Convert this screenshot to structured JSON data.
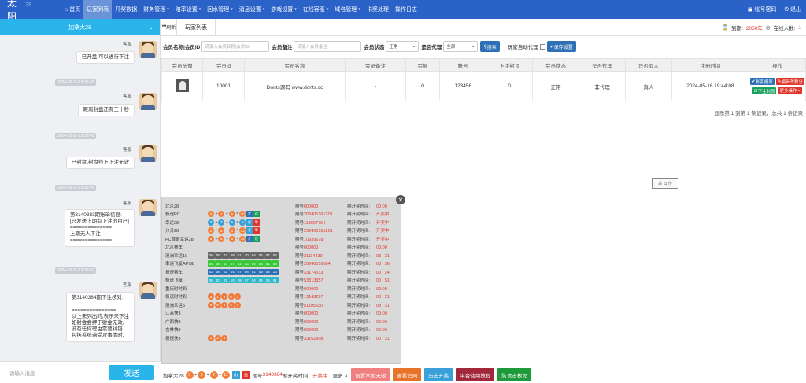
{
  "brand": {
    "name": "太阳",
    "sub": "28"
  },
  "nav": [
    {
      "label": "首页",
      "icon": "home-icon",
      "active": false
    },
    {
      "label": "玩家列表",
      "active": true
    },
    {
      "label": "开奖数据",
      "active": false
    },
    {
      "label": "财务管理",
      "active": false,
      "dropdown": true
    },
    {
      "label": "赔率设置",
      "active": false,
      "dropdown": true
    },
    {
      "label": "回水管理",
      "active": false,
      "dropdown": true
    },
    {
      "label": "消息设置",
      "active": false,
      "dropdown": true
    },
    {
      "label": "游戏设置",
      "active": false,
      "dropdown": true
    },
    {
      "label": "在线客服",
      "active": false,
      "dropdown": true
    },
    {
      "label": "域名管理",
      "active": false,
      "dropdown": true
    },
    {
      "label": "卡奖处理",
      "active": false
    },
    {
      "label": "操作日志",
      "active": false
    }
  ],
  "top_right": {
    "password": "帐号密码",
    "logout": "退出"
  },
  "chat": {
    "title": "加拿大28",
    "messages": [
      {
        "sender": "客服",
        "text": "已开盘,可以进行下注"
      },
      {
        "time": "2024-05-16 19:33:45",
        "sender": "客服",
        "text": "距离封盘还有三十秒"
      },
      {
        "time": "2024-05-16 19:33:46",
        "sender": "客服",
        "text": "已封盘,封盘线下下注无效"
      },
      {
        "time": "2024-05-16 19:33:46",
        "sender": "客服",
        "text": "第3140383期账单信息:\n[只发送上期有下注的用户]\n==============\n上期无人下注\n=============="
      },
      {
        "time": "2024-05-16 19:33:51",
        "sender": "客服",
        "text": "第3140384期下注核对:\n\n===============\n以上未列出的,表示未下注\n如射金会押于射金无效,\n没有任何理由需要纠错.\n包括系统遍受攻事情时."
      }
    ],
    "input_placeholder": "请输入消息",
    "send_label": "发送"
  },
  "tabs": {
    "close_label": "刷新",
    "current": "玩家列表"
  },
  "expire": {
    "label": "到期:",
    "value": "2050年",
    "online_label": "在线人数:",
    "online_count": "1"
  },
  "filters": {
    "member_label": "会员名称|会员ID",
    "member_placeholder": "请输入会员名称|会员ID",
    "note_label": "会员备注",
    "note_placeholder": "请输入会员备注",
    "status_label": "会员状态",
    "status_value": "正常",
    "agent_label": "是否代理",
    "agent_value": "全部",
    "search_label": "搜索",
    "auto_agent_label": "玩家自动代理",
    "save_label": "保存设置"
  },
  "table": {
    "headers": [
      "会员头像",
      "会员id",
      "会员名称",
      "会员备注",
      "余额",
      "帐号",
      "下注封顶",
      "会员状态",
      "是否代理",
      "是否假人",
      "注册时间",
      "操作"
    ],
    "rows": [
      {
        "id": "10001",
        "name": "Donts源码 www.donts.cc",
        "note": "-",
        "balance": "0",
        "account": "123456",
        "cap": "0",
        "status": "正常",
        "agent": "非代理",
        "fake": "真人",
        "reg_time": "2024-05-16 19:44:08"
      }
    ],
    "actions": {
      "bill": "账变报表",
      "edit_score": "编辑改积分",
      "cap": "下注封顶",
      "more": "更多操作"
    }
  },
  "pager": "显示第 1 到第 1 条记录，总共 1 条记录",
  "stamp_text": "采 山 作",
  "results": [
    {
      "name": "北京28",
      "balls": [],
      "dist": "000000",
      "open": "00:00",
      "open_red": false
    },
    {
      "name": "极速PC",
      "balls": [
        "0",
        "4",
        "6",
        "10"
      ],
      "tags": [
        [
          "大",
          "#2d70b5"
        ],
        [
          "双",
          "#19a05a"
        ]
      ],
      "dist": "202405161201",
      "open": "开奖中",
      "open_red": true,
      "style": "pc"
    },
    {
      "name": "幸运28",
      "balls": [
        "0",
        "3",
        "6",
        "9"
      ],
      "tags": [
        [
          "小",
          "#3aa0d8"
        ],
        [
          "单",
          "#e0352b"
        ]
      ],
      "dist": "113027764",
      "open": "开奖中",
      "open_red": true,
      "style": "lucky"
    },
    {
      "name": "分分28",
      "balls": [
        "0",
        "8",
        "5",
        "13"
      ],
      "tags": [
        [
          "小",
          "#3aa0d8"
        ],
        [
          "单",
          "#e0352b"
        ]
      ],
      "dist": "202405161201",
      "open": "开奖中",
      "open_red": true,
      "style": "pc"
    },
    {
      "name": "PC首富幸运28",
      "balls": [
        "5",
        "5",
        "6",
        "16"
      ],
      "tags": [
        [
          "大",
          "#2d70b5"
        ],
        [
          "双",
          "#19a05a"
        ]
      ],
      "dist": "10939678",
      "open": "开奖中",
      "open_red": true,
      "style": "pc"
    },
    {
      "name": "北京赛车",
      "balls": [],
      "dist": "000000",
      "open": "00:00",
      "open_red": false
    },
    {
      "name": "澳洲幸运10",
      "balls": [
        "08",
        "06",
        "03",
        "09",
        "01",
        "10",
        "04",
        "05",
        "07",
        "02"
      ],
      "dist": "21114430",
      "open": "03 : 31",
      "open_red": false,
      "style": "pk_gray"
    },
    {
      "name": "幸运飞艇API68",
      "balls": [
        "09",
        "06",
        "10",
        "07",
        "02",
        "03",
        "04",
        "05",
        "01",
        "08"
      ],
      "dist": "20240516084",
      "open": "03 : 36",
      "open_red": false,
      "style": "pk_green"
    },
    {
      "name": "极速赛车",
      "balls": [
        "03",
        "06",
        "02",
        "04",
        "07",
        "08",
        "01",
        "09",
        "05",
        "10"
      ],
      "dist": "33174033",
      "open": "00 : 24",
      "open_red": false,
      "style": "pk_blue"
    },
    {
      "name": "极速飞艇",
      "balls": [
        "08",
        "03",
        "02",
        "10",
        "09",
        "07",
        "04",
        "06",
        "05",
        "01"
      ],
      "dist": "53813357",
      "open": "00 : 51",
      "open_red": false,
      "style": "pk_teal"
    },
    {
      "name": "重庆时时彩",
      "balls": [],
      "dist": "000000",
      "open": "00:00",
      "open_red": false
    },
    {
      "name": "极速时时彩",
      "balls": [
        "6",
        "1",
        "9",
        "6",
        "3"
      ],
      "dist": "13143297",
      "open": "00 : 21",
      "open_red": false,
      "style": "ssc"
    },
    {
      "name": "澳洲幸运5",
      "balls": [
        "9",
        "8",
        "9",
        "4",
        "4"
      ],
      "dist": "51105530",
      "open": "03 : 31",
      "open_red": false,
      "style": "ssc"
    },
    {
      "name": "江苏快3",
      "balls": [],
      "dist": "000000",
      "open": "00:00",
      "open_red": false
    },
    {
      "name": "广西快3",
      "balls": [],
      "dist": "000000",
      "open": "00:00",
      "open_red": false
    },
    {
      "name": "吉林快3",
      "balls": [],
      "dist": "000000",
      "open": "00:00",
      "open_red": false
    },
    {
      "name": "极速快3",
      "balls": [
        "2",
        "3",
        "6"
      ],
      "dist": "33162908",
      "open": "00 : 21",
      "open_red": false,
      "style": "ssc"
    }
  ],
  "result_labels": {
    "dist_label": "期号",
    "open_label": "期开奖时间:"
  },
  "bottom": {
    "game": "加拿大28",
    "balls": [
      "3",
      "6",
      "2",
      "11"
    ],
    "tags": [
      [
        "小",
        "#3aa0d8"
      ],
      [
        "单",
        "#e0352b"
      ]
    ],
    "dist_label": "期号",
    "dist": "3140384",
    "open_label": "期开奖时间:",
    "open": "开奖中",
    "more": "更多 ∧",
    "buttons": [
      {
        "label": "设置本期无效",
        "color": "#f08080"
      },
      {
        "label": "查看官网",
        "color": "#e8742b"
      },
      {
        "label": "历史开奖",
        "color": "#3aa0d8"
      },
      {
        "label": "平台使用教程",
        "color": "#a0283a"
      },
      {
        "label": "防攻击教程",
        "color": "#1e9a3a"
      }
    ]
  }
}
